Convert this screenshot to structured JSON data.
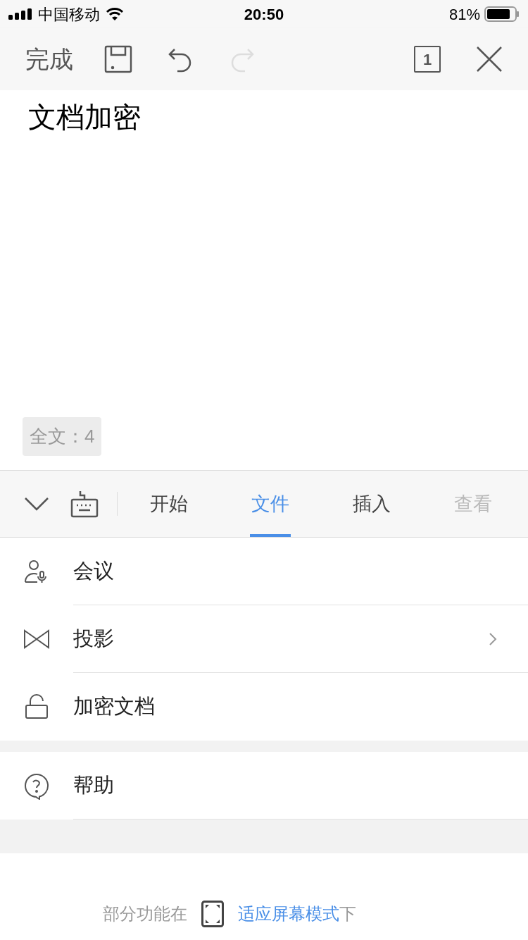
{
  "status_bar": {
    "carrier": "中国移动",
    "time": "20:50",
    "battery": "81%"
  },
  "toolbar": {
    "done": "完成",
    "redo_disabled": true,
    "page_count": "1"
  },
  "document": {
    "text": "文档加密",
    "word_count": "全文：4"
  },
  "tabs": [
    {
      "label": "开始",
      "selected": false,
      "faded": false
    },
    {
      "label": "文件",
      "selected": true,
      "faded": false
    },
    {
      "label": "插入",
      "selected": false,
      "faded": false
    },
    {
      "label": "查看",
      "selected": false,
      "faded": true
    }
  ],
  "menu_groups": [
    [
      {
        "kind": "meeting",
        "label": "会议",
        "has_arrow": false
      },
      {
        "kind": "projection",
        "label": "投影",
        "has_arrow": true
      },
      {
        "kind": "lock",
        "label": "加密文档",
        "has_arrow": false
      }
    ],
    [
      {
        "kind": "help",
        "label": "帮助",
        "has_arrow": false
      }
    ]
  ],
  "footer": {
    "before": "部分功能在",
    "link": "适应屏幕模式",
    "after": "下"
  }
}
